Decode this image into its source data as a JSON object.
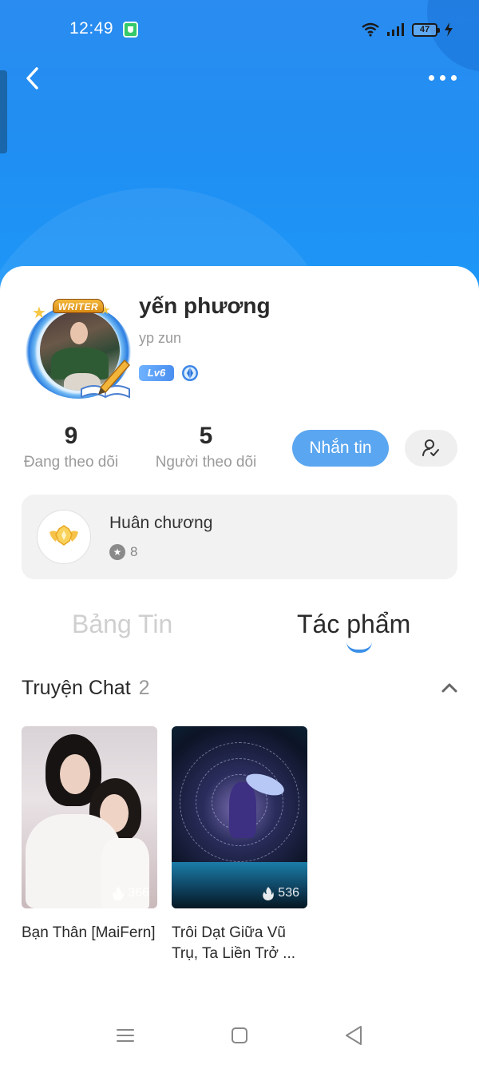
{
  "status_bar": {
    "time": "12:49",
    "battery": "47"
  },
  "profile": {
    "name": "yến phương",
    "handle": "yp zun",
    "level": "Lv6",
    "avatar_badge": "WRITER"
  },
  "stats": {
    "following": {
      "count": "9",
      "label": "Đang theo dõi"
    },
    "followers": {
      "count": "5",
      "label": "Người theo dõi"
    }
  },
  "actions": {
    "message_label": "Nhắn tin"
  },
  "medals": {
    "title": "Huân chương",
    "count": "8"
  },
  "tabs": [
    {
      "label": "Bảng Tin",
      "active": false
    },
    {
      "label": "Tác phẩm",
      "active": true
    }
  ],
  "section": {
    "title": "Truyện Chat",
    "count": "2"
  },
  "stories": [
    {
      "title": "Bạn Thân [MaiFern]",
      "views": "366"
    },
    {
      "title": "Trôi Dạt Giữa Vũ Trụ, Ta Liền Trở ...",
      "views": "536"
    }
  ],
  "colors": {
    "header_blue": "#1f8ff3",
    "accent_blue": "#5aa6f0",
    "underline_blue": "#3a8fe8"
  }
}
